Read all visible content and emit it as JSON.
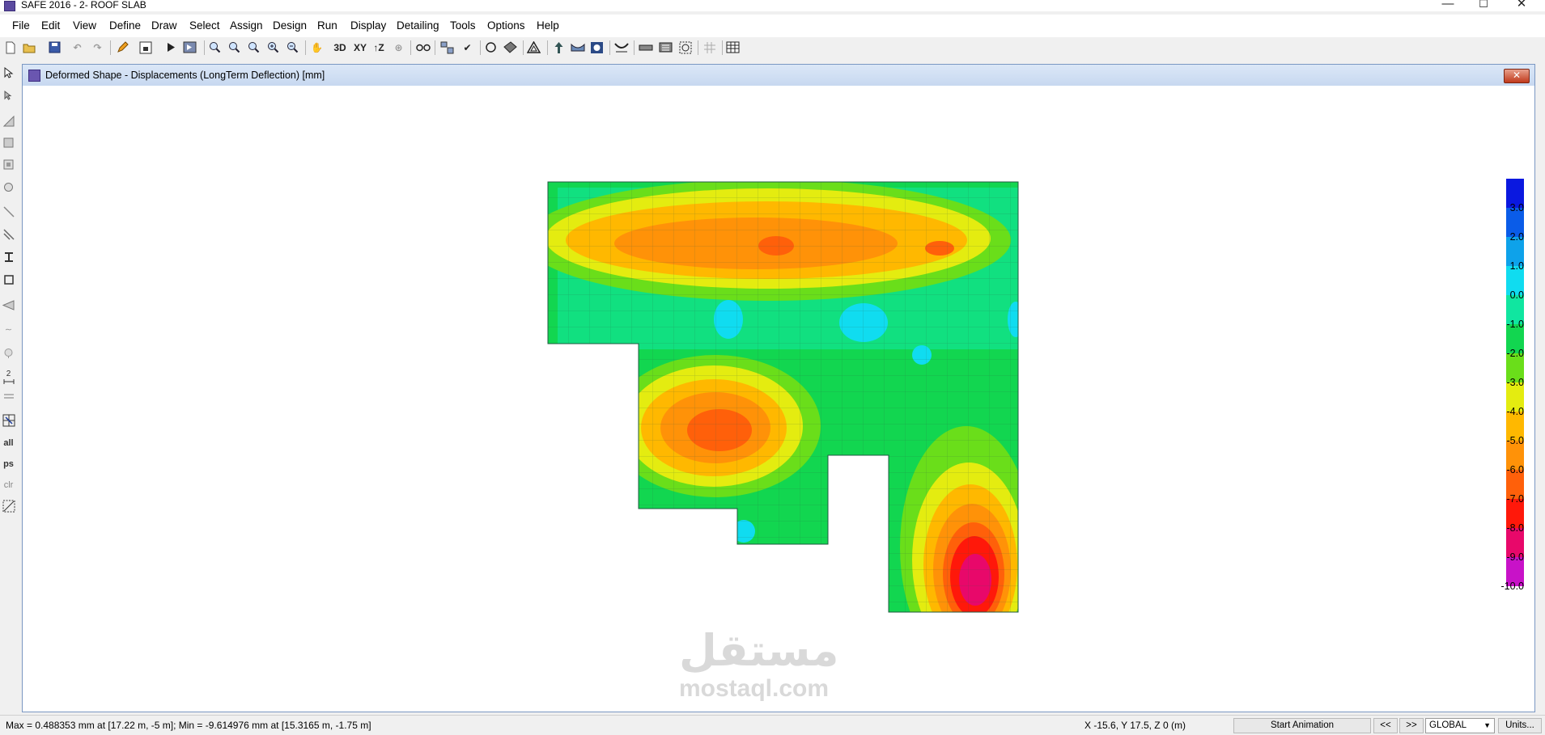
{
  "app": {
    "title": "SAFE 2016 - 2- ROOF SLAB",
    "window_controls": [
      "—",
      "☐",
      "✕"
    ]
  },
  "menu": [
    "File",
    "Edit",
    "View",
    "Define",
    "Draw",
    "Select",
    "Assign",
    "Design",
    "Run",
    "Display",
    "Detailing",
    "Tools",
    "Options",
    "Help"
  ],
  "toolbar": {
    "view_3d": "3D",
    "view_xy": "XY",
    "view_tz": "↑Z"
  },
  "left_toolbar": {
    "all": "all",
    "ps": "ps",
    "clr": "clr",
    "number": "2"
  },
  "document": {
    "title": "Deformed Shape - Displacements (LongTerm Deflection)  [mm]",
    "close": "✕"
  },
  "legend": {
    "labels": [
      "3.0",
      "2.0",
      "1.0",
      "0.0",
      "-1.0",
      "-2.0",
      "-3.0",
      "-4.0",
      "-5.0",
      "-6.0",
      "-7.0",
      "-8.0",
      "-9.0",
      "-10.0"
    ],
    "colors": [
      "#0a18e0",
      "#0a5ce8",
      "#0ea2ea",
      "#10dcf0",
      "#10e6a0",
      "#12d650",
      "#6ade1a",
      "#e4ec10",
      "#ffb800",
      "#ff9208",
      "#ff600a",
      "#ff180a",
      "#e8086a",
      "#c812c8"
    ]
  },
  "watermark": {
    "arabic": "مستقل",
    "latin": "mostaql.com"
  },
  "status": {
    "max_min": "Max = 0.488353 mm at [17.22 m, -5 m];  Min = -9.614976 mm at [15.3165 m, -1.75 m]",
    "coords": "X -15.6,  Y 17.5,  Z 0  (m)",
    "start_animation": "Start Animation",
    "prev": "<<",
    "next": ">>",
    "coord_system": "GLOBAL",
    "units": "Units..."
  }
}
